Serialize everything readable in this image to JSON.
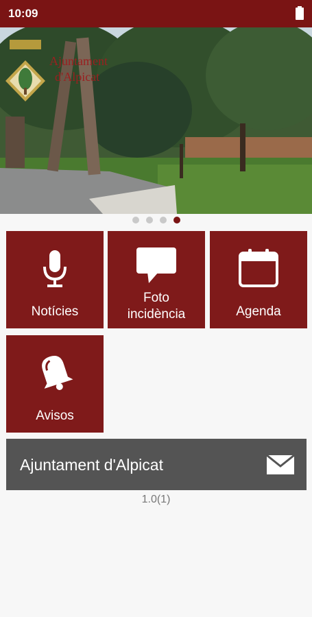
{
  "status": {
    "time": "10:09"
  },
  "banner": {
    "logo_text": "Ajuntament d'Alpicat",
    "indicator": {
      "total": 4,
      "active": 4
    }
  },
  "tiles": [
    {
      "label": "Notícies",
      "icon": "microphone-icon"
    },
    {
      "label": "Foto incidència",
      "label_line1": "Foto",
      "label_line2": "incidència",
      "icon": "speech-bubble-icon"
    },
    {
      "label": "Agenda",
      "icon": "calendar-icon"
    },
    {
      "label": "Avisos",
      "icon": "bell-icon"
    }
  ],
  "contact": {
    "name": "Ajuntament d'Alpicat",
    "icon": "mail-icon"
  },
  "version": "1.0(1)",
  "colors": {
    "brand": "#7f1a1a",
    "status_bar": "#7a1414",
    "contact_bar": "#545454"
  }
}
